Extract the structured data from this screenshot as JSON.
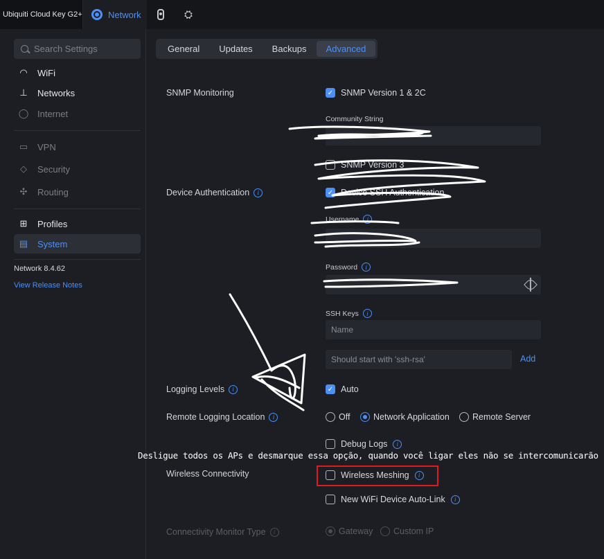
{
  "topbar": {
    "device": "Ubiquiti Cloud Key G2+",
    "network_tab": "Network"
  },
  "sidebar": {
    "search_placeholder": "Search Settings",
    "items": [
      {
        "label": "WiFi",
        "icon": "wifi-icon"
      },
      {
        "label": "Networks",
        "icon": "networks-icon"
      },
      {
        "label": "Internet",
        "icon": "globe-icon"
      },
      {
        "label": "VPN",
        "icon": "vpn-icon"
      },
      {
        "label": "Security",
        "icon": "shield-icon"
      },
      {
        "label": "Routing",
        "icon": "routing-icon"
      },
      {
        "label": "Profiles",
        "icon": "profiles-icon"
      },
      {
        "label": "System",
        "icon": "system-icon"
      }
    ],
    "version": "Network 8.4.62",
    "release_notes": "View Release Notes"
  },
  "tabs": [
    "General",
    "Updates",
    "Backups",
    "Advanced"
  ],
  "settings": {
    "snmp_label": "SNMP Monitoring",
    "snmp_v1_label": "SNMP Version 1 & 2C",
    "community_string_label": "Community String",
    "snmp_v3_label": "SNMP Version 3",
    "device_auth_label": "Device Authentication",
    "device_ssh_label": "Device SSH Authentication",
    "username_label": "Username",
    "password_label": "Password",
    "ssh_keys_label": "SSH Keys",
    "ssh_name_placeholder": "Name",
    "ssh_key_placeholder": "Should start with 'ssh-rsa'",
    "add_label": "Add",
    "logging_levels_label": "Logging Levels",
    "auto_label": "Auto",
    "remote_logging_label": "Remote Logging Location",
    "radio_off": "Off",
    "radio_network_app": "Network Application",
    "radio_remote_server": "Remote Server",
    "debug_logs_label": "Debug Logs",
    "wireless_connectivity_label": "Wireless Connectivity",
    "wireless_meshing_label": "Wireless Meshing",
    "auto_link_label": "New WiFi Device Auto-Link",
    "conn_monitor_label": "Connectivity Monitor Type",
    "gateway_label": "Gateway",
    "custom_ip_label": "Custom IP"
  },
  "annotation": {
    "note": "Desligue todos os APs e desmarque essa opção, quando você ligar eles não se intercomunicarão"
  },
  "colors": {
    "accent": "#4d90f5",
    "highlight_box": "#e11b1b",
    "background": "#1c1e24"
  }
}
